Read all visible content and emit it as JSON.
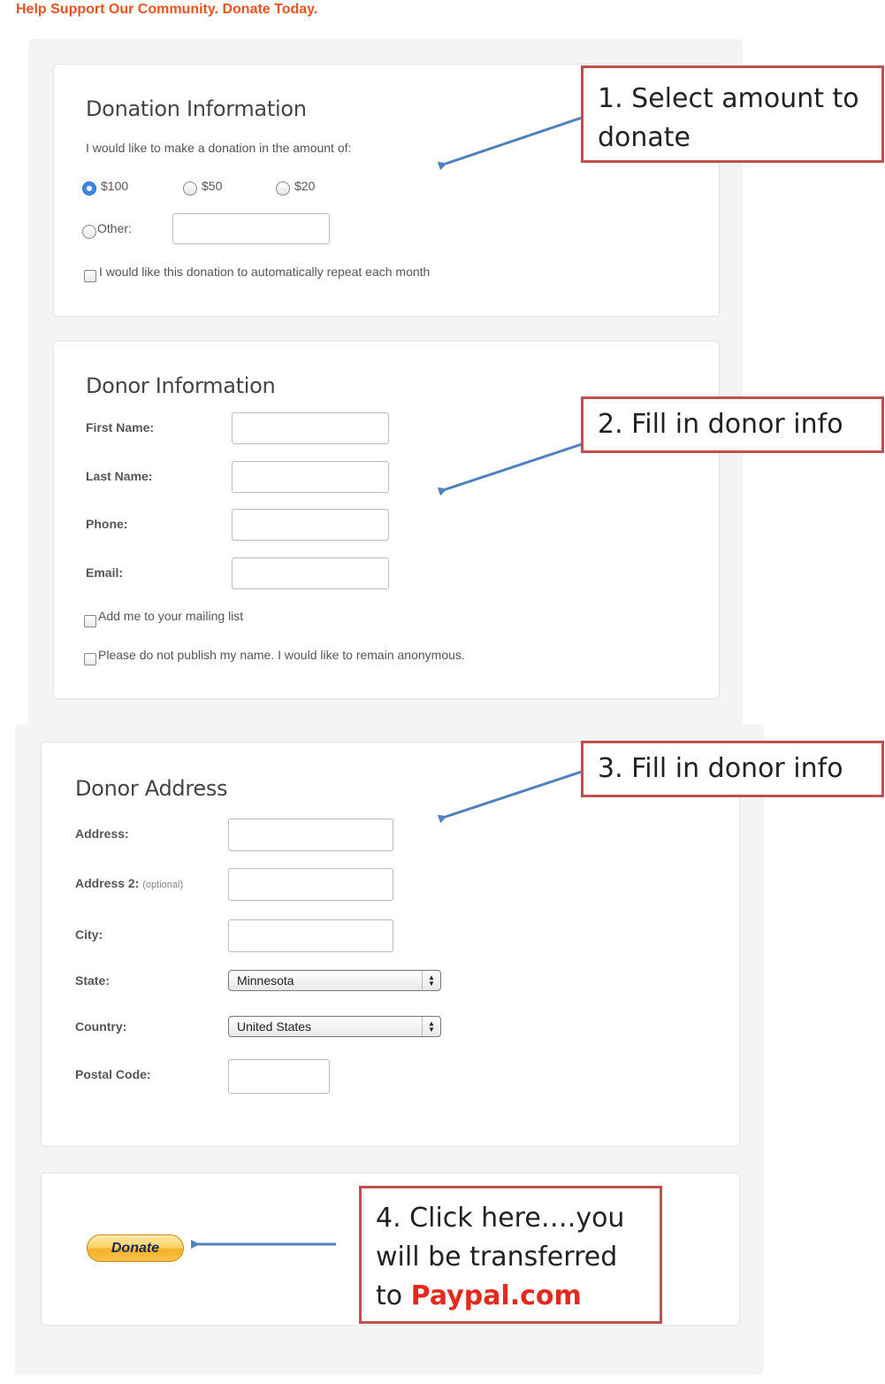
{
  "header": {
    "banner": "Help Support Our Community. Donate Today."
  },
  "donation": {
    "title": "Donation Information",
    "prompt": "I would like to make a donation in the amount of:",
    "amounts": [
      "$100",
      "$50",
      "$20"
    ],
    "selected": "$100",
    "other_label": "Other:",
    "other_value": "",
    "repeat_label": "I would like this donation to automatically repeat each month"
  },
  "donor": {
    "title": "Donor Information",
    "first_name_label": "First Name:",
    "last_name_label": "Last Name:",
    "phone_label": "Phone:",
    "email_label": "Email:",
    "mailing_label": "Add me to your mailing list",
    "anon_label": "Please do not publish my name. I would like to remain anonymous."
  },
  "address": {
    "title": "Donor Address",
    "address_label": "Address:",
    "address2_label": "Address 2:",
    "address2_optional": "(optional)",
    "city_label": "City:",
    "state_label": "State:",
    "state_value": "Minnesota",
    "country_label": "Country:",
    "country_value": "United States",
    "postal_label": "Postal Code:"
  },
  "donate_button": {
    "label": "Donate"
  },
  "callouts": {
    "c1": "1. Select amount to donate",
    "c2": "2. Fill in donor info",
    "c3": "3. Fill in donor info",
    "c4_line1": "4. Click here….you",
    "c4_line2": "will be transferred",
    "c4_prefix": "to ",
    "c4_link": "Paypal.com"
  },
  "colors": {
    "banner": "#e8531f",
    "callout_border": "#c0504d",
    "arrow": "#4f81bd",
    "paypal_text": "#e22a1e"
  }
}
